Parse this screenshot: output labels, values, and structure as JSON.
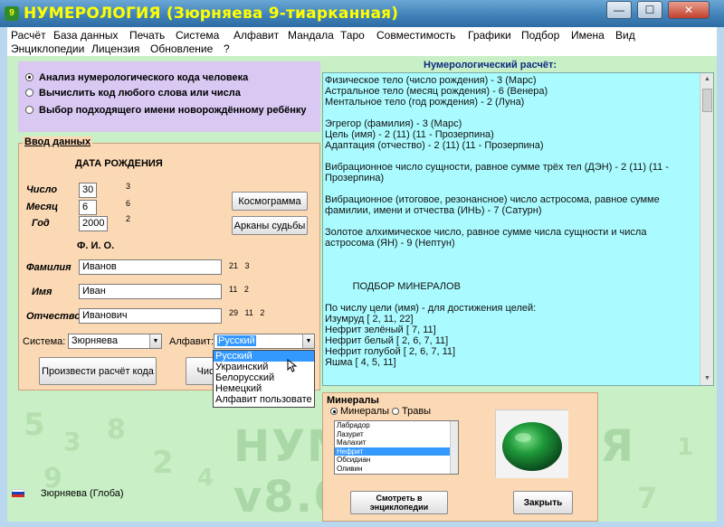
{
  "window": {
    "title": "НУМЕРОЛОГИЯ (Зюрняева 9-тиарканная)",
    "app_icon_glyph": "9"
  },
  "window_controls": {
    "minimize": "—",
    "maximize": "☐",
    "close": "✕"
  },
  "menu": {
    "row1": [
      "Расчёт",
      "База данных",
      "Печать",
      "Система",
      "Алфавит",
      "Мандала",
      "Таро",
      "Совместимость",
      "Графики",
      "Подбор",
      "Имена",
      "Вид"
    ],
    "row2": [
      "Энциклопедии",
      "Лицензия",
      "Обновление",
      "?"
    ]
  },
  "modes": {
    "items": [
      "Анализ нумерологического кода человека",
      "Вычислить код любого слова или числа",
      "Выбор подходящего имени новорождённому ребёнку"
    ],
    "selected_index": 0
  },
  "input": {
    "group_label": "Ввод данных",
    "birth_header": "ДАТА РОЖДЕНИЯ",
    "day_label": "Число",
    "day_value": "30",
    "day_code": "3",
    "month_label": "Месяц",
    "month_value": "6",
    "month_code": "6",
    "year_label": "Год",
    "year_value": "2000",
    "year_code": "2",
    "fio_header": "Ф. И. О.",
    "surname_label": "Фамилия",
    "surname_value": "Иванов",
    "surname_code_a": "21",
    "surname_code_b": "3",
    "name_label": "Имя",
    "name_value": "Иван",
    "name_code_a": "11",
    "name_code_b": "2",
    "patronymic_label": "Отчество",
    "patronymic_value": "Иванович",
    "patronymic_code_a": "29",
    "patronymic_code_b": "11",
    "patronymic_code_c": "2",
    "system_label": "Система:",
    "system_value": "Зюрняева",
    "alphabet_label": "Алфавит:",
    "alphabet_value": "Русский",
    "alphabet_options": [
      "Русский",
      "Украинский",
      "Белорусский",
      "Немецкий",
      "Алфавит пользовате"
    ],
    "alphabet_selected_index": 0
  },
  "buttons": {
    "cosmogram": "Космограмма",
    "arcana": "Арканы судьбы",
    "calculate": "Произвести расчёт кода",
    "hidden_partial": "Чис",
    "view_encyclopedia": "Смотреть в энциклопедии",
    "close": "Закрыть"
  },
  "result": {
    "title": "Нумерологический расчёт:",
    "text": "Физическое тело (число рождения) - 3 (Марс)\nАстральное тело (месяц рождения) - 6 (Венера)\nМентальное тело (год рождения) - 2 (Луна)\n\nЭгрегор (фамилия) - 3 (Марс)\nЦель (имя) - 2 (11) (11 - Прозерпина)\nАдаптация (отчество) - 2 (11) (11 - Прозерпина)\n\nВибрационное число сущности, равное сумме трёх тел (ДЭН) - 2 (11) (11 - Прозерпина)\n\nВибрационное (итоговое, резонансное) число астросома, равное сумме фамилии, имени и отчества (ИНЬ) - 7 (Сатурн)\n\nЗолотое алхимическое число, равное сумме числа сущности и числа астросома (ЯН) - 9 (Нептун)\n\n\n\n          ПОДБОР МИНЕРАЛОВ\n\nПо числу цели (имя) - для достижения целей:\nИзумруд [ 2, 11, 22]\nНефрит зелёный [ 7, 11]\nНефрит белый [ 2, 6, 7, 11]\nНефрит голубой [ 2, 6, 7, 11]\nЯшма [ 4, 5, 11]"
  },
  "minerals": {
    "group_label": "Минералы",
    "tab_minerals": "Минералы",
    "tab_herbs": "Травы",
    "list": [
      "Лабрадор",
      "Лазурит",
      "Малахит",
      "Нефрит",
      "Обсидиан",
      "Оливин"
    ],
    "selected_index": 3
  },
  "watermark": "НУМЕРОЛОГИЯ v8.0",
  "status": {
    "text": "Зюрняева (Глоба)"
  },
  "colors": {
    "accent_title": "#ffff00",
    "client_bg": "#c8efc5",
    "result_bg": "#aafbff",
    "panel_bg": "#fbd9b5",
    "mode_panel_bg": "#d8c8f2",
    "selection": "#3399ff",
    "result_title": "#0d2c84"
  }
}
